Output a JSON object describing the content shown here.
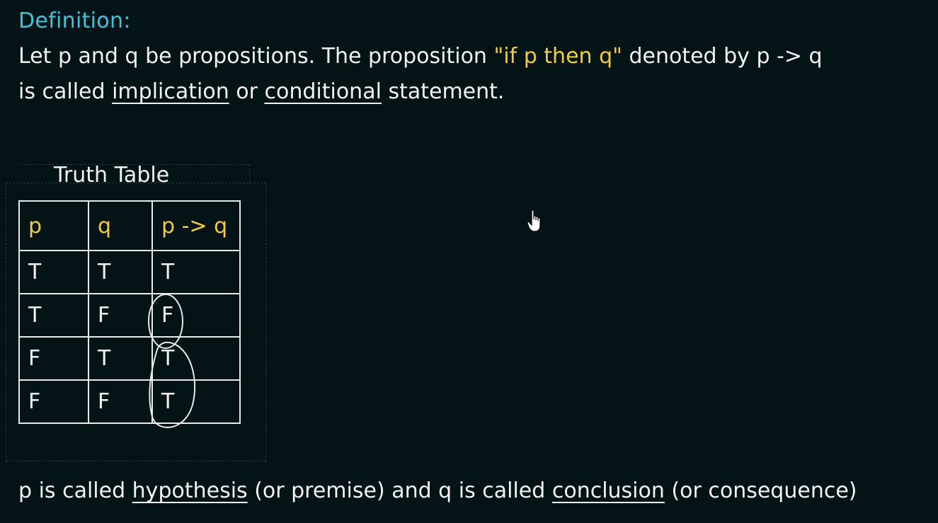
{
  "definition": {
    "heading": "Definition:",
    "line1_a": "Let p and q be propositions. The proposition ",
    "line1_quote": "\"if p then q\"",
    "line1_b": "  denoted by p -> q",
    "line2_a": "is called ",
    "line2_term1": "implication",
    "line2_b": " or ",
    "line2_term2": "conditional",
    "line2_c": " statement."
  },
  "truth_table": {
    "title": "Truth Table",
    "headers": [
      "p",
      "q",
      "p -> q"
    ],
    "rows": [
      [
        "T",
        "T",
        "T"
      ],
      [
        "T",
        "F",
        "F"
      ],
      [
        "F",
        "T",
        "T"
      ],
      [
        "F",
        "F",
        "T"
      ]
    ]
  },
  "footer": {
    "a": "p is called ",
    "term1": "hypothesis",
    "b": " (or premise) and q is called ",
    "term2": "conclusion",
    "c": " (or consequence)"
  },
  "colors": {
    "background": "#041416",
    "heading": "#3fc3d8",
    "highlight": "#f3cc3a",
    "text": "#f2f2f2"
  },
  "icons": [
    "hand-pointer-cursor-icon"
  ]
}
